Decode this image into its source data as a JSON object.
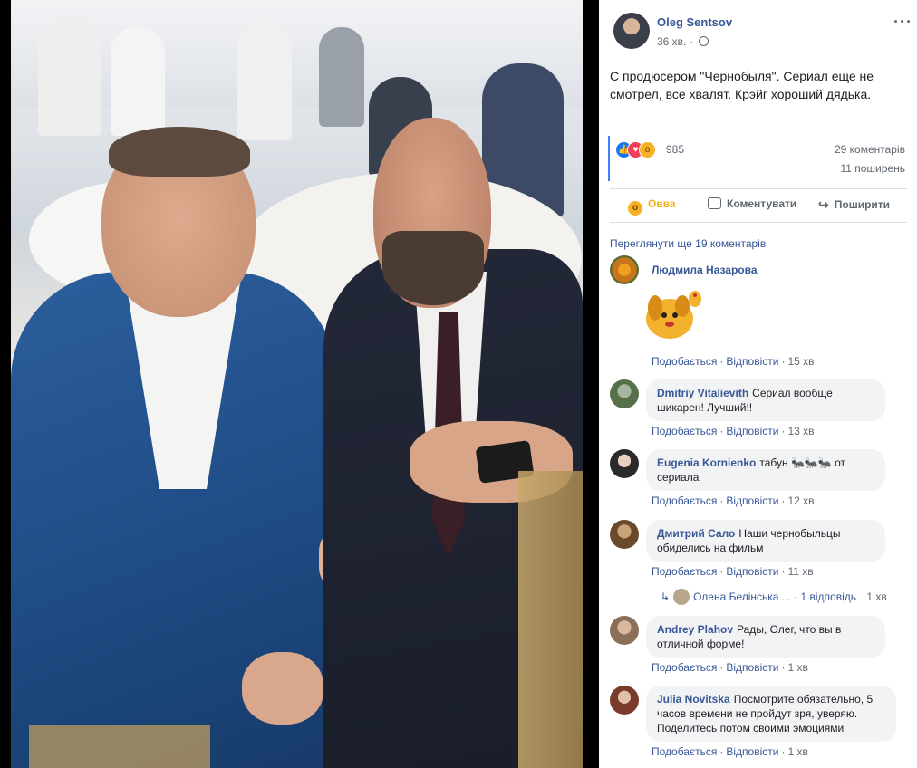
{
  "post": {
    "author": "Oleg Sentsov",
    "time": "36 хв.",
    "text": "С продюсером \"Чернобыля\". Сериал еще не смотрел, все хвалят. Крэйг хороший дядька.",
    "reaction_count": "985",
    "comments_count": "29 коментарів",
    "shares_count": "11 поширень",
    "icons": {
      "more": "more-dots-icon",
      "audience": "globe-icon"
    }
  },
  "actions": {
    "wow": "Овва",
    "comment": "Коментувати",
    "share": "Поширити"
  },
  "view_more": "Переглянути ще 19 коментарів",
  "comment_actions": {
    "like": "Подобається",
    "reply": "Відповісти"
  },
  "comments": [
    {
      "name": "Людмила Назарова",
      "text": "",
      "time": "15 хв",
      "has_sticker": true
    },
    {
      "name": "Dmitriy Vitalievith",
      "text": "Сериал вообще шикарен! Лучший!!",
      "time": "13 хв"
    },
    {
      "name": "Eugenia Kornienko",
      "text": "табун 🐜🐜🐜 от сериала",
      "time": "12 хв"
    },
    {
      "name": "Дмитрий Сало",
      "text": "Наши чернобыльцы обиделись на фильм",
      "time": "11 хв"
    },
    {
      "name": "Andrey Plahov",
      "text": "Рады, Олег, что вы в отличной форме!",
      "time": "1 хв"
    },
    {
      "name": "Julia Novitska",
      "text": "Посмотрите обязательно, 5 часов времени не пройдут зря, уверяю. Поделитесь потом своими эмоциями",
      "time": "1 хв"
    }
  ],
  "replies": {
    "name": "Олена Белінська ...",
    "count": "1 відповідь",
    "time": "1 хв"
  },
  "colors": {
    "link": "#385898",
    "meta": "#606770",
    "bubble": "#f2f3f5",
    "wow": "#f7b125",
    "like": "#1877f2",
    "love": "#f33e58"
  }
}
